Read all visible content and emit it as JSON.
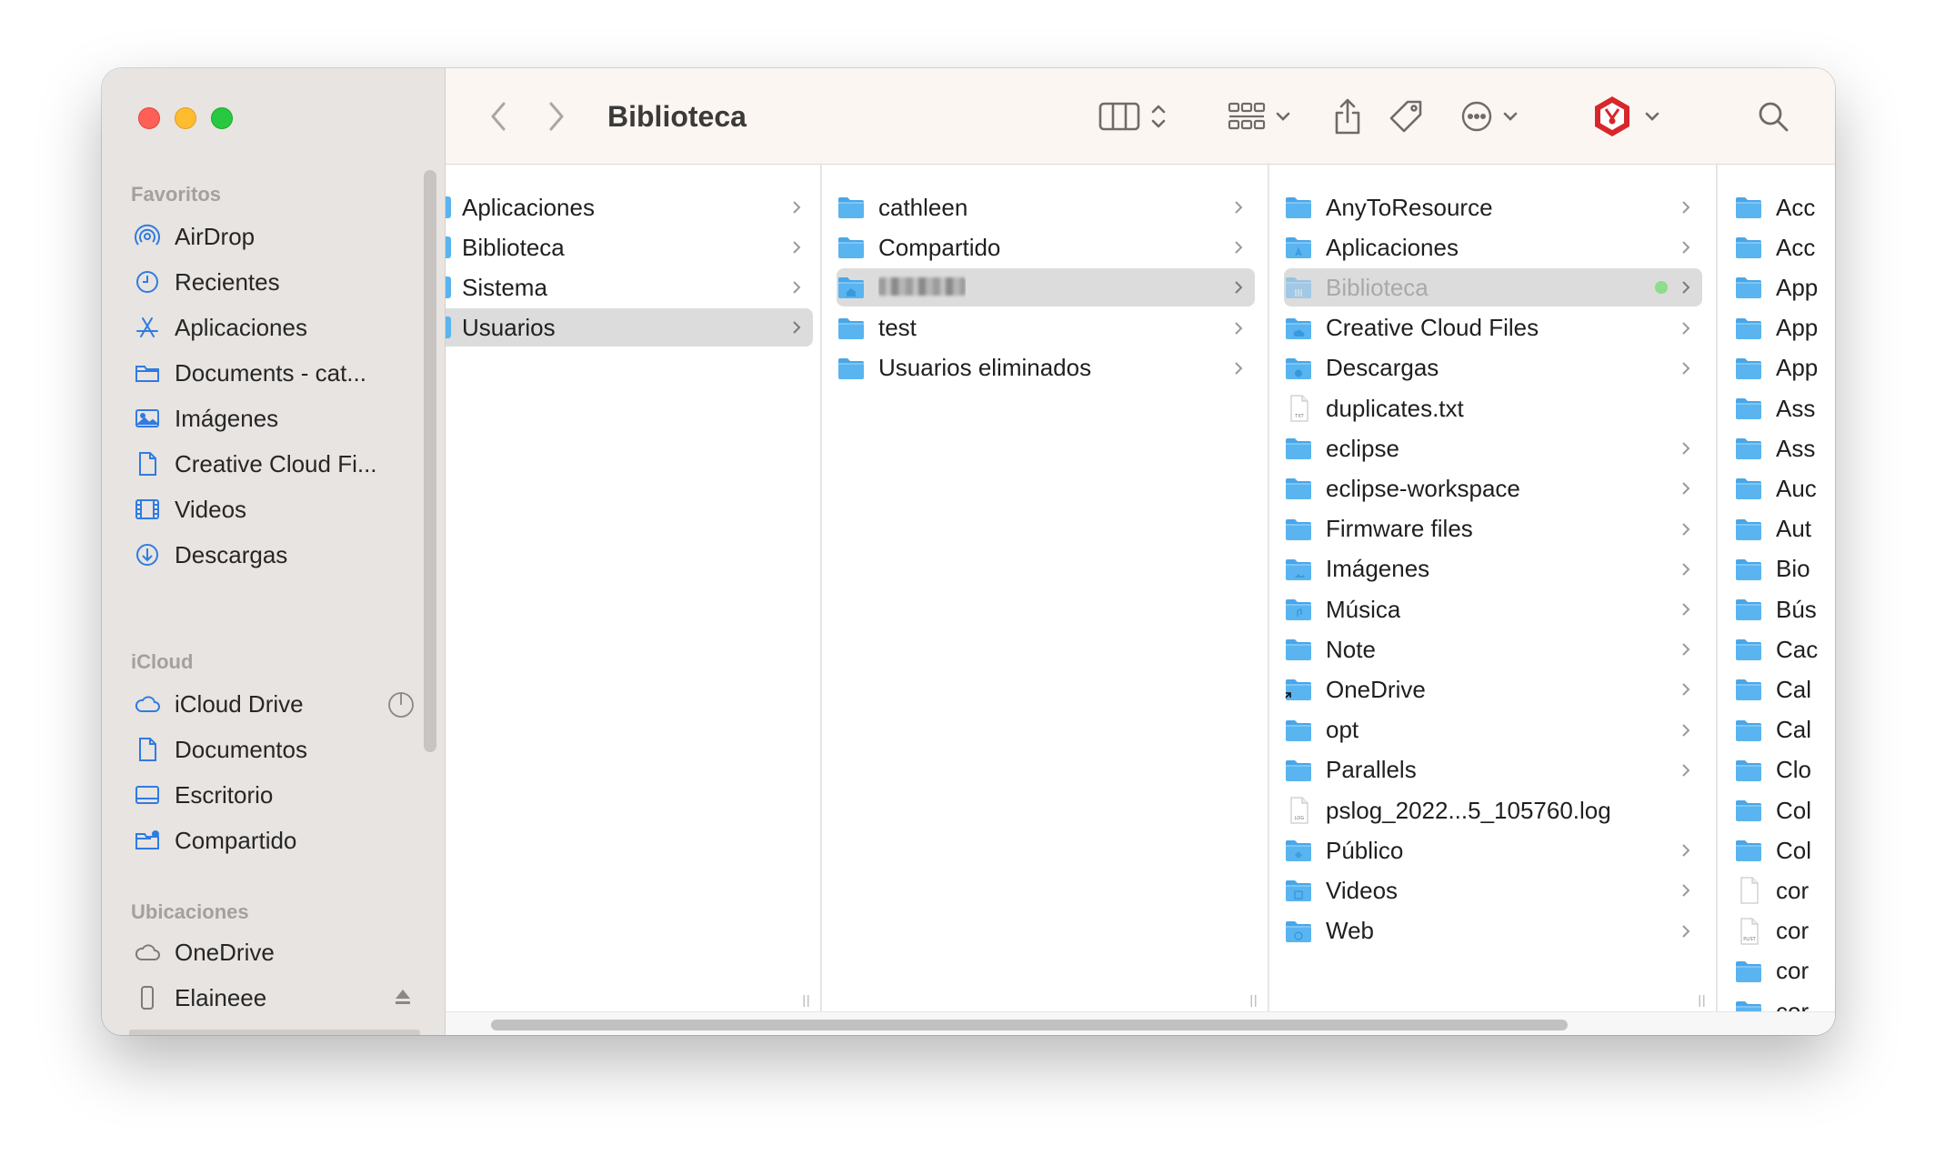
{
  "window": {
    "title": "Biblioteca"
  },
  "sidebar": {
    "sections": [
      {
        "label": "Favoritos",
        "items": [
          {
            "label": "AirDrop",
            "icon": "airdrop-icon"
          },
          {
            "label": "Recientes",
            "icon": "clock-icon"
          },
          {
            "label": "Aplicaciones",
            "icon": "apps-icon"
          },
          {
            "label": "Documents - cat...",
            "icon": "folder-icon"
          },
          {
            "label": "Imágenes",
            "icon": "photo-icon"
          },
          {
            "label": "Creative Cloud Fi...",
            "icon": "document-icon"
          },
          {
            "label": "Videos",
            "icon": "film-icon"
          },
          {
            "label": "Descargas",
            "icon": "download-icon"
          }
        ]
      },
      {
        "label": "iCloud",
        "items": [
          {
            "label": "iCloud Drive",
            "icon": "cloud-icon"
          },
          {
            "label": "Documentos",
            "icon": "document-icon"
          },
          {
            "label": "Escritorio",
            "icon": "desktop-icon"
          },
          {
            "label": "Compartido",
            "icon": "shared-folder-icon"
          }
        ]
      },
      {
        "label": "Ubicaciones",
        "items": [
          {
            "label": "OneDrive",
            "icon": "cloud-icon"
          },
          {
            "label": "Elaineee",
            "icon": "phone-icon"
          }
        ]
      }
    ]
  },
  "columns": [
    {
      "items": [
        {
          "label": "Aplicaciones"
        },
        {
          "label": "Biblioteca"
        },
        {
          "label": "Sistema"
        },
        {
          "label": "Usuarios",
          "selected": true
        }
      ]
    },
    {
      "items": [
        {
          "label": "cathleen"
        },
        {
          "label": "Compartido"
        },
        {
          "label": "",
          "selected": true
        },
        {
          "label": "test"
        },
        {
          "label": "Usuarios eliminados"
        }
      ]
    },
    {
      "items": [
        {
          "label": "AnyToResource"
        },
        {
          "label": "Aplicaciones"
        },
        {
          "label": "Biblioteca",
          "selected": true
        },
        {
          "label": "Creative Cloud Files"
        },
        {
          "label": "Descargas"
        },
        {
          "label": "duplicates.txt"
        },
        {
          "label": "eclipse"
        },
        {
          "label": "eclipse-workspace"
        },
        {
          "label": "Firmware files"
        },
        {
          "label": "Imágenes"
        },
        {
          "label": "Música"
        },
        {
          "label": "Note"
        },
        {
          "label": "OneDrive"
        },
        {
          "label": "opt"
        },
        {
          "label": "Parallels"
        },
        {
          "label": "pslog_2022...5_105760.log"
        },
        {
          "label": "Público"
        },
        {
          "label": "Videos"
        },
        {
          "label": "Web"
        }
      ]
    },
    {
      "items": [
        {
          "label": "Acc"
        },
        {
          "label": "Acc"
        },
        {
          "label": "App"
        },
        {
          "label": "App"
        },
        {
          "label": "App"
        },
        {
          "label": "Ass"
        },
        {
          "label": "Ass"
        },
        {
          "label": "Auc"
        },
        {
          "label": "Aut"
        },
        {
          "label": "Bio"
        },
        {
          "label": "Bús"
        },
        {
          "label": "Cac"
        },
        {
          "label": "Cal"
        },
        {
          "label": "Cal"
        },
        {
          "label": "Clo"
        },
        {
          "label": "Col"
        },
        {
          "label": "Col"
        },
        {
          "label": "cor"
        },
        {
          "label": "cor"
        },
        {
          "label": "cor"
        },
        {
          "label": "cor"
        }
      ]
    }
  ],
  "colors": {
    "accent_folder": "#5ab4f0",
    "sidebar_icon": "#2f7be2"
  }
}
